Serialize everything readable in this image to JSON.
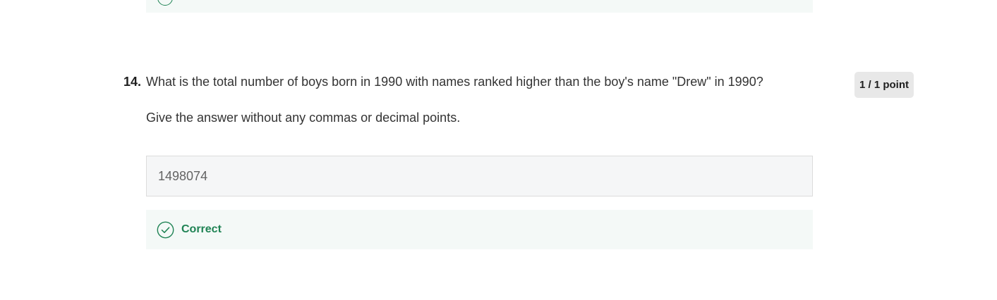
{
  "question": {
    "number": "14.",
    "text": "What is the total number of boys born in 1990 with names ranked higher than the boy's name \"Drew\" in 1990?",
    "instruction": "Give the answer without any commas or decimal points.",
    "points": "1 / 1 point"
  },
  "answer": {
    "value": "1498074"
  },
  "feedback": {
    "status": "Correct",
    "icon": "check-circle-icon",
    "color": "#1f8354"
  }
}
